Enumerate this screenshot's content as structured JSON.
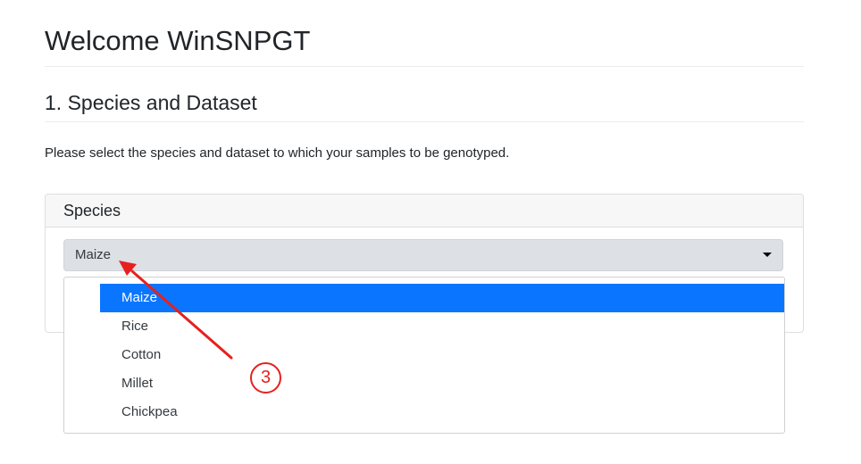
{
  "header": {
    "title": "Welcome WinSNPGT"
  },
  "section": {
    "title": "1. Species and Dataset",
    "instructions": "Please select the species and dataset to which your samples to be genotyped."
  },
  "species_card": {
    "title": "Species",
    "select": {
      "value": "Maize"
    },
    "options": [
      {
        "label": "Maize",
        "selected": true
      },
      {
        "label": "Rice"
      },
      {
        "label": "Cotton"
      },
      {
        "label": "Millet"
      },
      {
        "label": "Chickpea"
      }
    ]
  },
  "annotation": {
    "step_number": "3",
    "color": "#e62020"
  },
  "colors": {
    "accent": "#0a76ff",
    "select_bg": "#dde0e5"
  }
}
